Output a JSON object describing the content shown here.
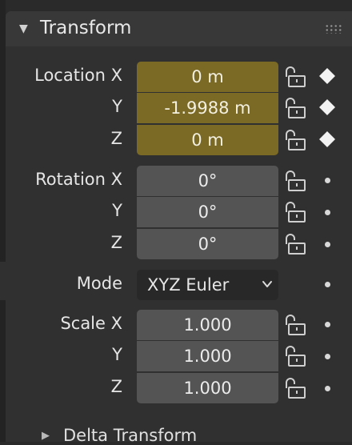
{
  "panel": {
    "title": "Transform",
    "collapse_icon": "triangle-down-icon",
    "grip_icon": "drag-grip-icon"
  },
  "location": {
    "label_x": "Location X",
    "label_y": "Y",
    "label_z": "Z",
    "x": "0 m",
    "y": "-1.9988 m",
    "z": "0 m",
    "field_color": "#7a6a26",
    "keyframe_icon": "keyframe-diamond-icon"
  },
  "rotation": {
    "label_x": "Rotation X",
    "label_y": "Y",
    "label_z": "Z",
    "x": "0°",
    "y": "0°",
    "z": "0°"
  },
  "mode": {
    "label": "Mode",
    "value": "XYZ Euler"
  },
  "scale": {
    "label_x": "Scale X",
    "label_y": "Y",
    "label_z": "Z",
    "x": "1.000",
    "y": "1.000",
    "z": "1.000"
  },
  "delta": {
    "title": "Delta Transform",
    "expand_icon": "triangle-right-icon"
  },
  "icons": {
    "lock": "unlock-icon",
    "animate": "animate-dot-icon"
  }
}
